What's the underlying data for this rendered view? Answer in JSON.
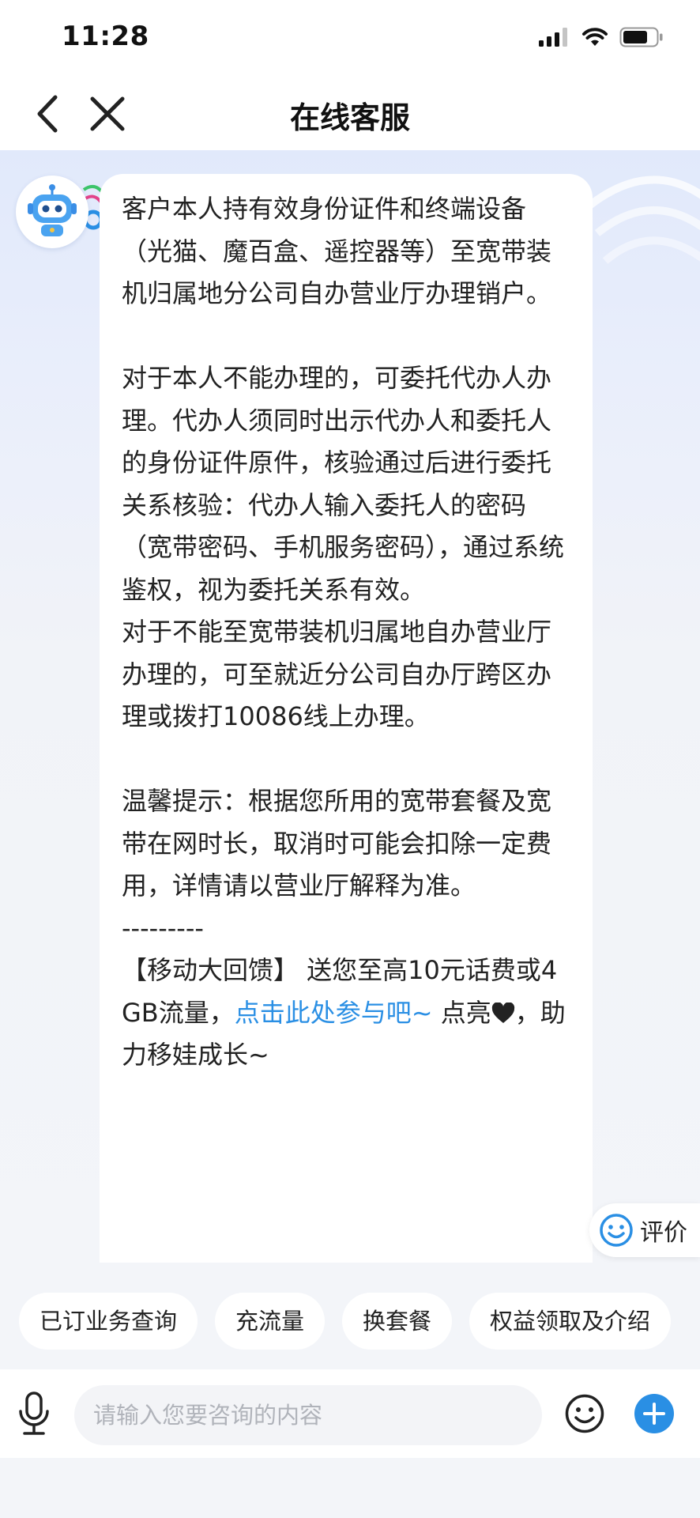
{
  "status_bar": {
    "time": "11:28",
    "icons": [
      "cellular-signal-icon",
      "wifi-icon",
      "battery-icon"
    ]
  },
  "nav": {
    "title": "在线客服",
    "back_icon": "chevron-left-icon",
    "close_icon": "close-icon"
  },
  "message": {
    "p1": "客户本人持有效身份证件和终端设备（光猫、魔百盒、遥控器等）至宽带装机归属地分公司自办营业厅办理销户。",
    "p2": "对于本人不能办理的，可委托代办人办理。代办人须同时出示代办人和委托人的身份证件原件，核验通过后进行委托关系核验：代办人输入委托人的密码（宽带密码、手机服务密码），通过系统鉴权，视为委托关系有效。",
    "p3": "对于不能至宽带装机归属地自办营业厅办理的，可至就近分公司自办厅跨区办理或拨打10086线上办理。",
    "p4": "温馨提示：根据您所用的宽带套餐及宽带在网时长，取消时可能会扣除一定费用，详情请以营业厅解释为准。",
    "divider": "---------",
    "promo_prefix": "【移动大回馈】 送您至高10元话费或4GB流量，",
    "promo_link": "点击此处参与吧~",
    "promo_mid": " 点亮",
    "promo_suffix": "，助力移娃成长~"
  },
  "evaluate": {
    "label": "评价"
  },
  "quick_replies": [
    "已订业务查询",
    "充流量",
    "换套餐",
    "权益领取及介绍"
  ],
  "input": {
    "placeholder": "请输入您要咨询的内容"
  },
  "colors": {
    "link": "#2a8fe4",
    "accent": "#2a8fe4",
    "background": "#f3f5f9"
  }
}
